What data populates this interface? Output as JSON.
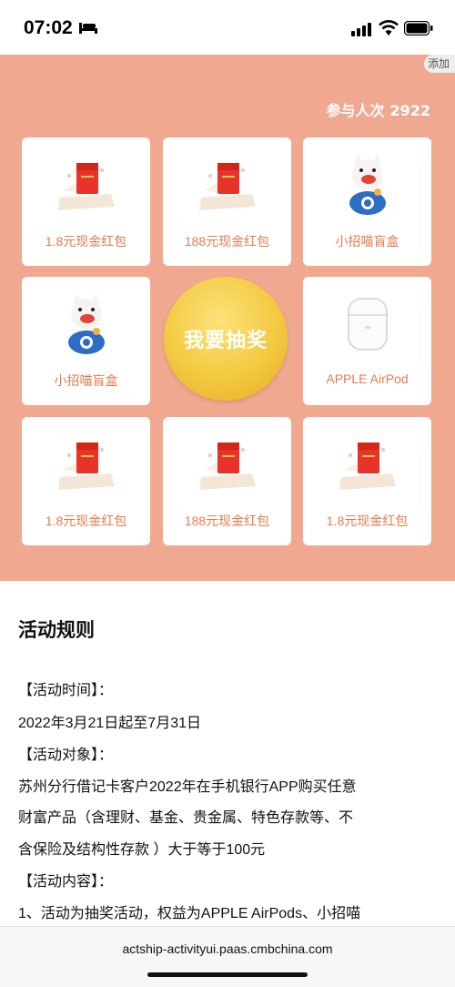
{
  "status": {
    "time": "07:02"
  },
  "header": {
    "add_tab": "添加",
    "participants_label": "参与人次",
    "participants_count": "2922"
  },
  "prizes": [
    {
      "label": "1.8元现金红包",
      "icon": "red-envelope"
    },
    {
      "label": "188元现金红包",
      "icon": "red-envelope"
    },
    {
      "label": "小招喵盲盒",
      "icon": "cat-figurine"
    },
    {
      "label": "小招喵盲盒",
      "icon": "cat-figurine"
    },
    {
      "label": "APPLE AirPod",
      "icon": "airpods"
    },
    {
      "label": "1.8元现金红包",
      "icon": "red-envelope"
    },
    {
      "label": "188元现金红包",
      "icon": "red-envelope"
    },
    {
      "label": "1.8元现金红包",
      "icon": "red-envelope"
    }
  ],
  "draw_button": {
    "label": "我要抽奖"
  },
  "rules": {
    "title": "活动规则",
    "lines": [
      "【活动时间】：",
      "2022年3月21日起至7月31日",
      "【活动对象】：",
      "苏州分行借记卡客户2022年在手机银行APP购买任意",
      "财富产品（含理财、基金、贵金属、特色存款等、不",
      "含保险及结构性存款 ）大于等于100元",
      "【活动内容】：",
      "1、活动为抽奖活动，权益为APPLE AirPods、小招喵"
    ]
  },
  "browser": {
    "url": "actship-activityui.paas.cmbchina.com"
  },
  "colors": {
    "background": "#f1a891",
    "prize_text": "#e57a4c",
    "button_gold": "#f3c940"
  }
}
